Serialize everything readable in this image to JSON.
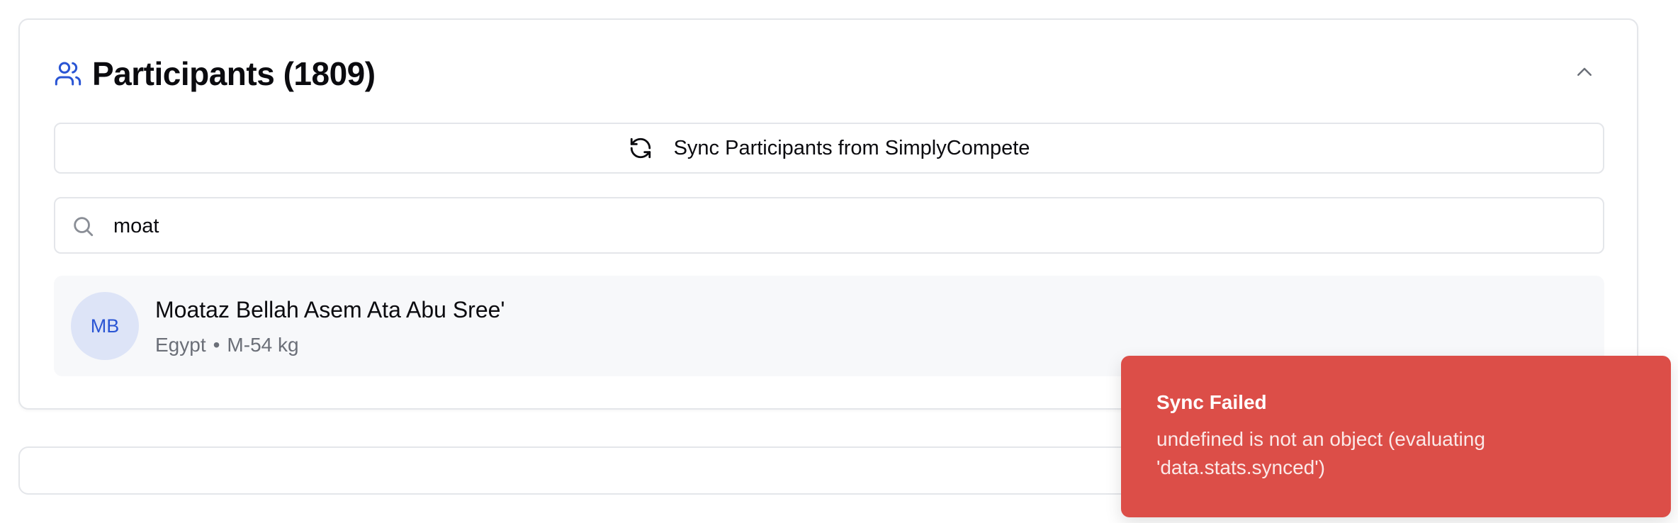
{
  "participants": {
    "title": "Participants (1809)",
    "sync_label": "Sync Participants from SimplyCompete",
    "search": {
      "value": "moat",
      "placeholder": ""
    },
    "results": [
      {
        "initials": "MB",
        "name": "Moataz Bellah Asem Ata Abu Sree'",
        "country": "Egypt",
        "separator": "•",
        "category": "M-54 kg"
      }
    ]
  },
  "toast": {
    "title": "Sync Failed",
    "message": "undefined is not an object (evaluating 'data.stats.synced')"
  },
  "icons": {
    "header": "users-icon",
    "collapse": "chevron-up-icon",
    "sync": "refresh-icon",
    "search": "search-icon"
  },
  "colors": {
    "accent": "#2a55d4",
    "avatar_bg": "#dde4f7",
    "toast_bg": "#dc4e48",
    "row_bg": "#f7f8fa",
    "border": "#e4e6ea",
    "muted_text": "#6b6f78"
  }
}
